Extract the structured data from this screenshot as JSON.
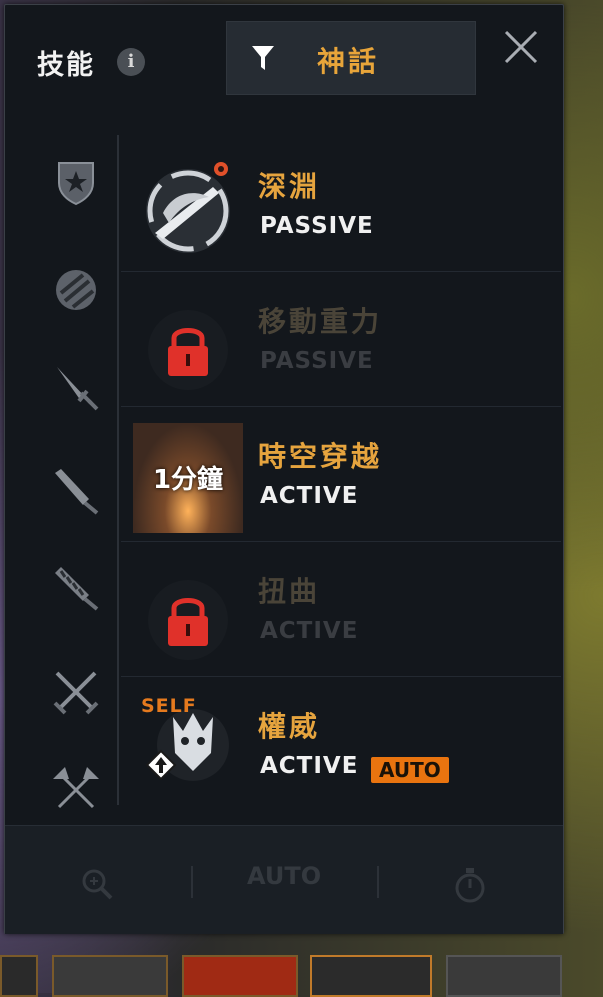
{
  "header": {
    "title": "技能",
    "info_icon": "info-icon",
    "filter_label": "神話",
    "filter_icon": "funnel-icon",
    "close_icon": "close-icon"
  },
  "sidebar": {
    "icons": [
      "shield-emblem-icon",
      "orb-icon",
      "dagger-icon",
      "greatsword-icon",
      "chain-blade-icon",
      "crossed-swords-icon",
      "crossed-axes-icon"
    ]
  },
  "skills": [
    {
      "name": "深淵",
      "type": "PASSIVE",
      "locked": false,
      "icon": "abyss-skill-icon"
    },
    {
      "name": "移動重力",
      "type": "PASSIVE",
      "locked": true,
      "icon": "lock-icon"
    },
    {
      "name": "時空穿越",
      "type": "ACTIVE",
      "locked": false,
      "icon": "time-travel-skill-icon",
      "cooldown": "1分鐘"
    },
    {
      "name": "扭曲",
      "type": "ACTIVE",
      "locked": true,
      "icon": "lock-icon"
    },
    {
      "name": "權威",
      "type": "ACTIVE",
      "locked": false,
      "icon": "authority-skill-icon",
      "tag": "SELF",
      "badge": "AUTO"
    }
  ],
  "bottom_bar": {
    "auto_label": "AUTO",
    "zoom_icon": "magnifier-icon",
    "timer_icon": "stopwatch-icon"
  },
  "colors": {
    "accent": "#e6a43e",
    "auto_badge": "#e9740f",
    "lock": "#e0312a",
    "panel": "#13171c"
  }
}
